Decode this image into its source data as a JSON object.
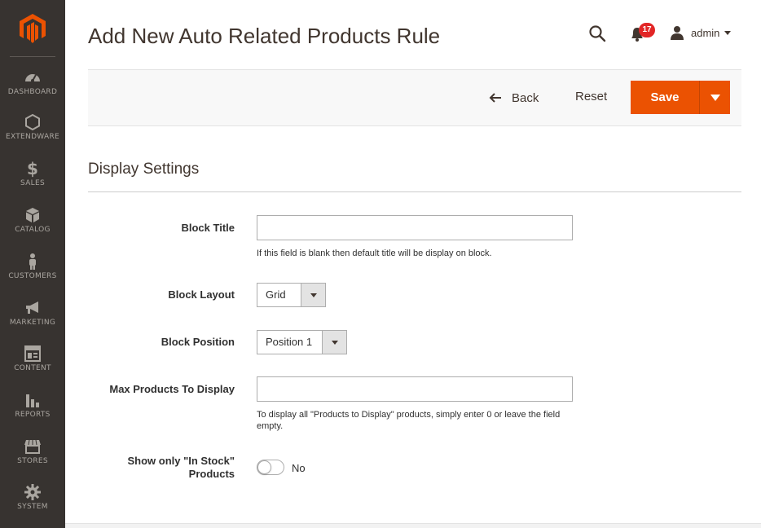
{
  "sidebar": {
    "items": [
      {
        "label": "DASHBOARD",
        "icon": "dashboard-icon"
      },
      {
        "label": "EXTENDWARE",
        "icon": "hexagon-icon"
      },
      {
        "label": "SALES",
        "icon": "dollar-icon"
      },
      {
        "label": "CATALOG",
        "icon": "box-icon"
      },
      {
        "label": "CUSTOMERS",
        "icon": "person-icon"
      },
      {
        "label": "MARKETING",
        "icon": "megaphone-icon"
      },
      {
        "label": "CONTENT",
        "icon": "layout-icon"
      },
      {
        "label": "REPORTS",
        "icon": "bar-chart-icon"
      },
      {
        "label": "STORES",
        "icon": "store-icon"
      },
      {
        "label": "SYSTEM",
        "icon": "gear-icon"
      }
    ]
  },
  "header": {
    "title": "Add New Auto Related Products Rule",
    "notification_count": "17",
    "user_name": "admin"
  },
  "actions": {
    "back_label": "Back",
    "reset_label": "Reset",
    "save_label": "Save"
  },
  "section": {
    "title": "Display Settings"
  },
  "form": {
    "block_title": {
      "label": "Block Title",
      "value": "",
      "note": "If this field is blank then default title will be display on block."
    },
    "block_layout": {
      "label": "Block Layout",
      "value": "Grid"
    },
    "block_position": {
      "label": "Block Position",
      "value": "Position 1"
    },
    "max_products": {
      "label": "Max Products To Display",
      "value": "",
      "note": "To display all \"Products to Display\" products, simply enter 0 or leave the field empty."
    },
    "in_stock": {
      "label_line1": "Show only \"In Stock\"",
      "label_line2": "Products",
      "value": "No"
    }
  },
  "colors": {
    "sidebar_bg": "#373330",
    "accent": "#eb5202",
    "badge": "#e22626"
  }
}
